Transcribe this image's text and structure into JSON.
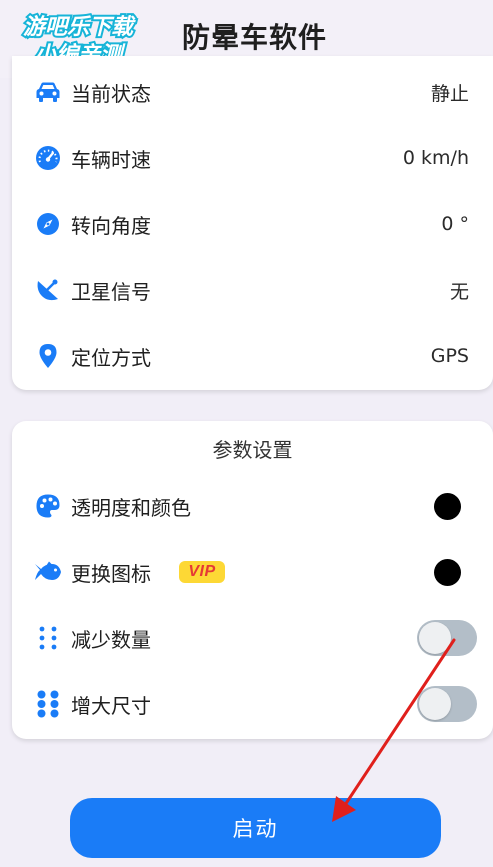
{
  "header": {
    "watermark_line1": "游吧乐下载",
    "watermark_line2": "小编亲测",
    "title": "防晕车软件"
  },
  "status": {
    "items": [
      {
        "icon": "car-icon",
        "label": "当前状态",
        "value": "静止"
      },
      {
        "icon": "speedometer-icon",
        "label": "车辆时速",
        "value": "0 km/h"
      },
      {
        "icon": "compass-icon",
        "label": "转向角度",
        "value": "0 °"
      },
      {
        "icon": "satellite-dish-icon",
        "label": "卫星信号",
        "value": "无"
      },
      {
        "icon": "location-pin-icon",
        "label": "定位方式",
        "value": "GPS"
      }
    ]
  },
  "settings": {
    "title": "参数设置",
    "items": [
      {
        "icon": "palette-icon",
        "label": "透明度和颜色",
        "control": "color-dot"
      },
      {
        "icon": "fish-icon",
        "label": "更换图标",
        "badge": "VIP",
        "control": "color-dot"
      },
      {
        "icon": "small-dots-icon",
        "label": "减少数量",
        "control": "toggle",
        "on": false
      },
      {
        "icon": "large-dots-icon",
        "label": "增大尺寸",
        "control": "toggle",
        "on": false
      }
    ]
  },
  "start_button": {
    "label": "启动"
  },
  "colors": {
    "accent": "#1a7cf7",
    "icon_blue": "#1a7cf7",
    "toggle_off": "#b3bec8",
    "vip_bg": "#fdd835",
    "vip_text": "#e53935",
    "arrow": "#e0201c"
  }
}
